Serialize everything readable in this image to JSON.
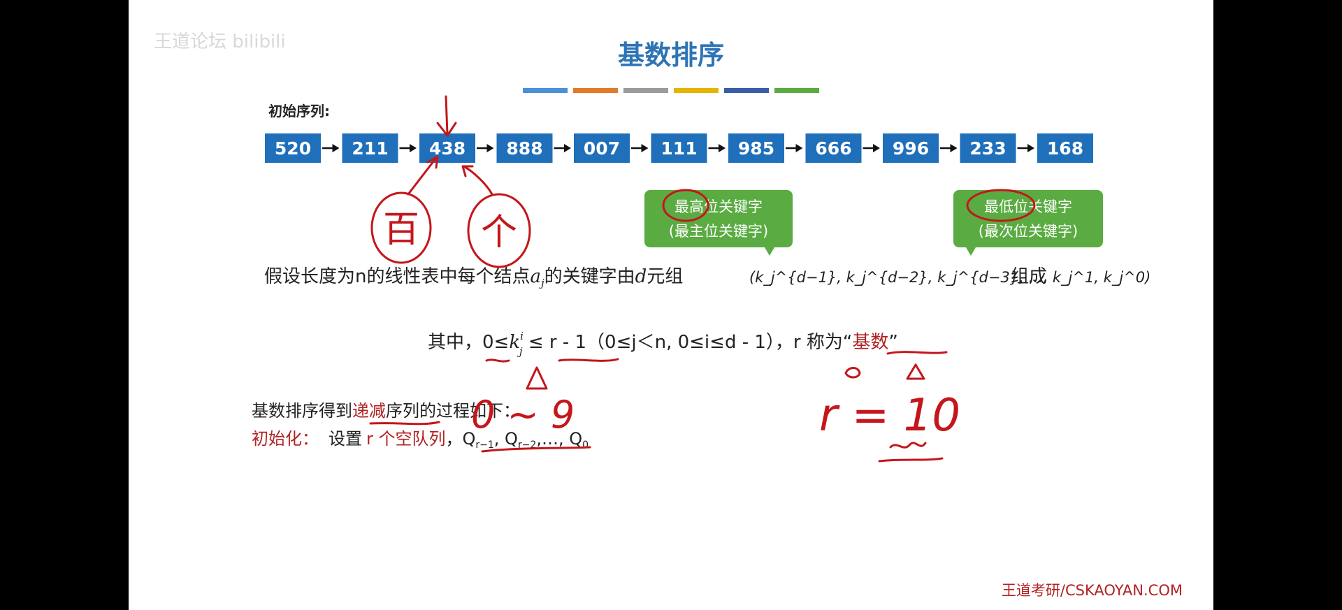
{
  "watermark_logo": "王道论坛 bilibili",
  "slide": {
    "title": "基数排序",
    "accent_colors": [
      "#4a90d9",
      "#e07b2a",
      "#9b9b9b",
      "#e6b400",
      "#3a5da8",
      "#5aab42"
    ],
    "initial_label": "初始序列:",
    "sequence": [
      "520",
      "211",
      "438",
      "888",
      "007",
      "111",
      "985",
      "666",
      "996",
      "233",
      "168"
    ],
    "box_color": "#1f6fba",
    "callouts": [
      {
        "line1": "最高位关键字",
        "line2": "(最主位关键字)"
      },
      {
        "line1": "最低位关键字",
        "line2": "(最次位关键字)"
      }
    ],
    "callout_color": "#5aab42",
    "line_assume": {
      "prefix": "假设长度为n的线性表中每个结点",
      "a_sym": "a",
      "a_sub": "j",
      "mid": "的关键字由",
      "d_sym": "d",
      "mid2": "元组",
      "tuple": "(k_j^{d−1}, k_j^{d−2}, k_j^{d−3}, …, k_j^1, k_j^0)",
      "suffix": "组成"
    },
    "line_where": {
      "prefix": "其中，",
      "ineq_left": "0≤",
      "k_sym": "k",
      "k_sup": "i",
      "k_sub": "j",
      "ineq_right": " ≤ r - 1",
      "range": "（0≤j＜n, 0≤i≤d - 1）",
      "r_text": "，r 称为“",
      "highlight": "基数",
      "close": "”"
    },
    "line_process": {
      "prefix": "基数排序得到",
      "highlight": "递减",
      "suffix": "序列的过程如下："
    },
    "line_init": {
      "label": "初始化：",
      "text1": "设置",
      "highlight": "r 个空队列",
      "queues": "，Q",
      "q1_sub": "r−1",
      "q2": ", Q",
      "q2_sub": "r−2",
      "q3": ",…, Q",
      "q3_sub": "0"
    },
    "footer": "王道考研/CSKAOYAN.COM"
  },
  "annotations": {
    "hand_left": "百",
    "hand_right": "个",
    "digits_range": "0 ~ 9",
    "r_equals": "r = 10"
  }
}
